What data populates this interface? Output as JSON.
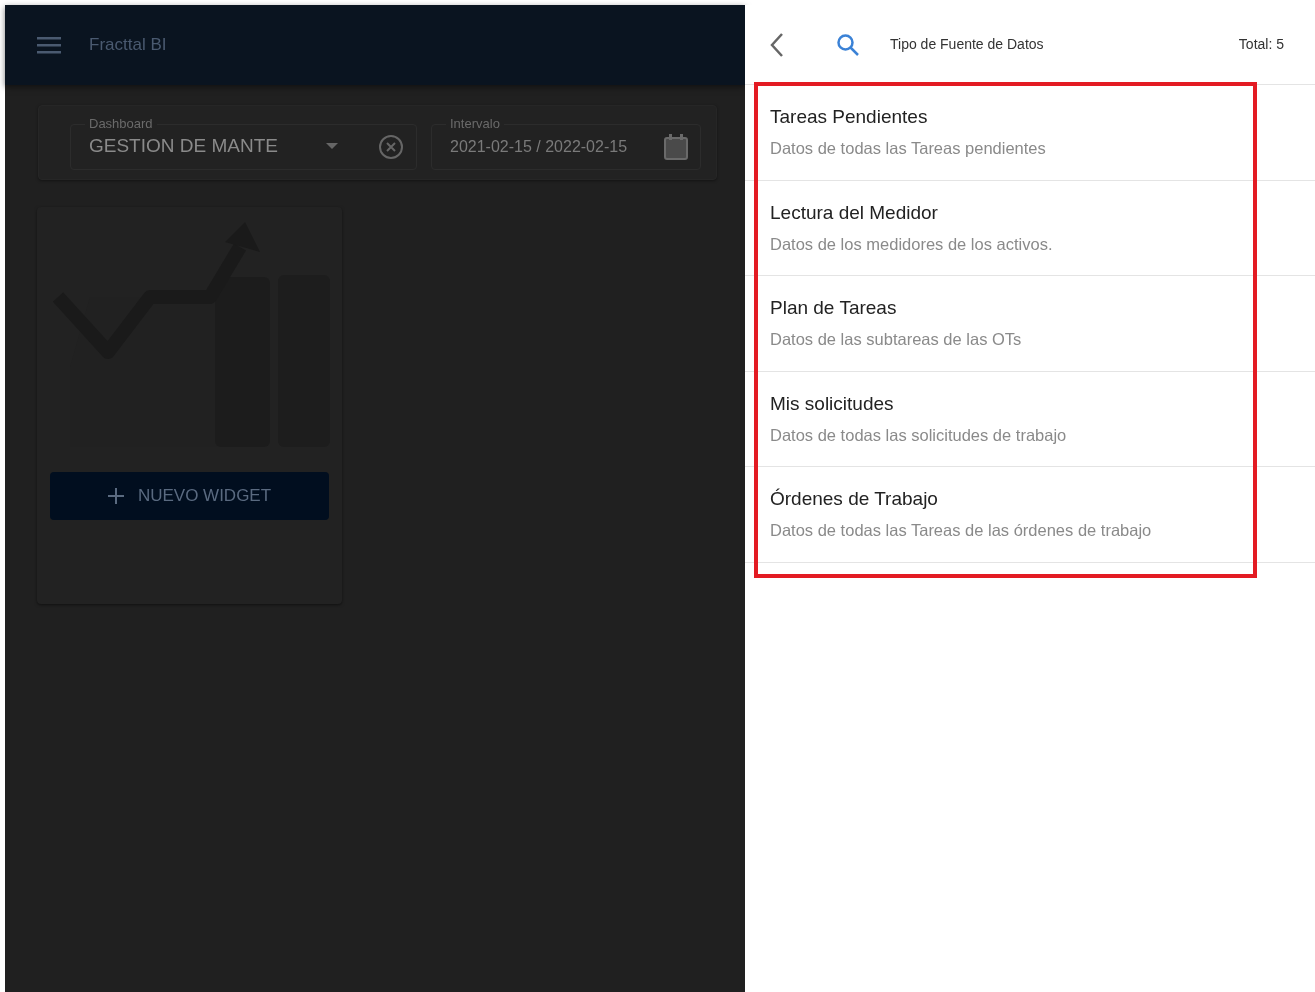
{
  "app_bar": {
    "title": "Fracttal BI"
  },
  "filters": {
    "dashboard": {
      "label": "Dashboard",
      "value": "GESTION DE MANTE"
    },
    "interval": {
      "label": "Intervalo",
      "value": "2021-02-15 / 2022-02-15"
    }
  },
  "widget_card": {
    "button": "NUEVO WIDGET"
  },
  "panel": {
    "title": "Tipo de Fuente de Datos",
    "total": "Total: 5",
    "highlighted": true,
    "items": [
      {
        "title": "Tareas Pendientes",
        "subtitle": "Datos de todas las Tareas pendientes"
      },
      {
        "title": "Lectura del Medidor",
        "subtitle": "Datos de los medidores de los activos."
      },
      {
        "title": "Plan de Tareas",
        "subtitle": "Datos de las subtareas de las OTs"
      },
      {
        "title": "Mis solicitudes",
        "subtitle": "Datos de todas las solicitudes de trabajo"
      },
      {
        "title": "Órdenes de Trabajo",
        "subtitle": "Datos de todas las Tareas de las órdenes de trabajo"
      }
    ]
  }
}
